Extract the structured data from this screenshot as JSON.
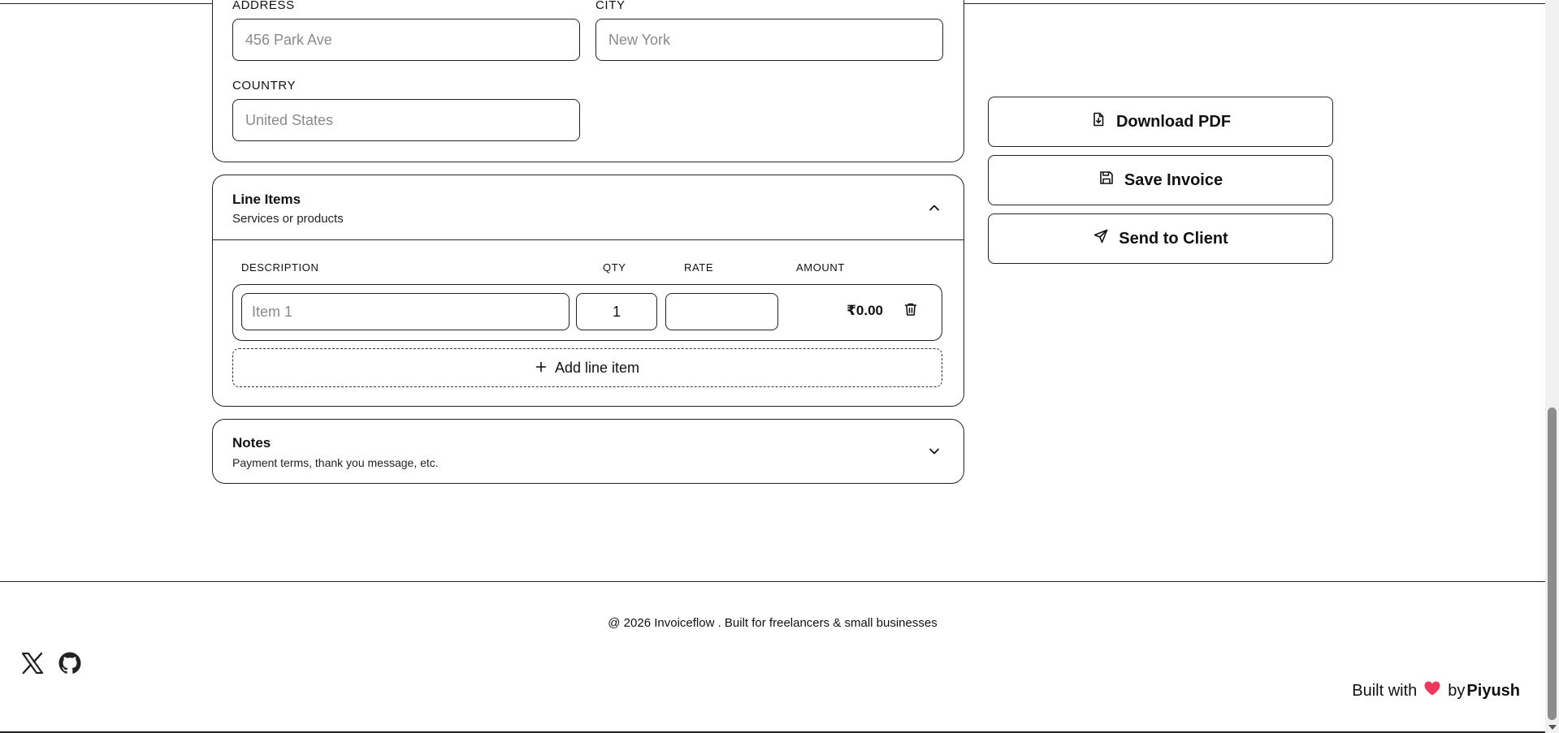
{
  "address_section": {
    "address_label": "ADDRESS",
    "address_placeholder": "456 Park Ave",
    "city_label": "CITY",
    "city_placeholder": "New York",
    "country_label": "COUNTRY",
    "country_placeholder": "United States"
  },
  "line_items": {
    "title": "Line Items",
    "subtitle": "Services or products",
    "columns": {
      "description": "DESCRIPTION",
      "qty": "QTY",
      "rate": "RATE",
      "amount": "AMOUNT"
    },
    "rows": [
      {
        "description_placeholder": "Item 1",
        "qty": "1",
        "rate": "",
        "amount": "₹0.00"
      }
    ],
    "add_label": "Add line item"
  },
  "notes": {
    "title": "Notes",
    "subtitle": "Payment terms, thank you message, etc."
  },
  "actions": {
    "download": "Download PDF",
    "save": "Save Invoice",
    "send": "Send to Client"
  },
  "footer": {
    "copyright": "@ 2026 Invoiceflow . Built for freelancers & small businesses",
    "built_with": "Built with",
    "by": "by",
    "author": "Piyush",
    "heart_color": "#f0365b"
  },
  "icons": {
    "social": [
      "x-icon",
      "github-icon"
    ]
  }
}
